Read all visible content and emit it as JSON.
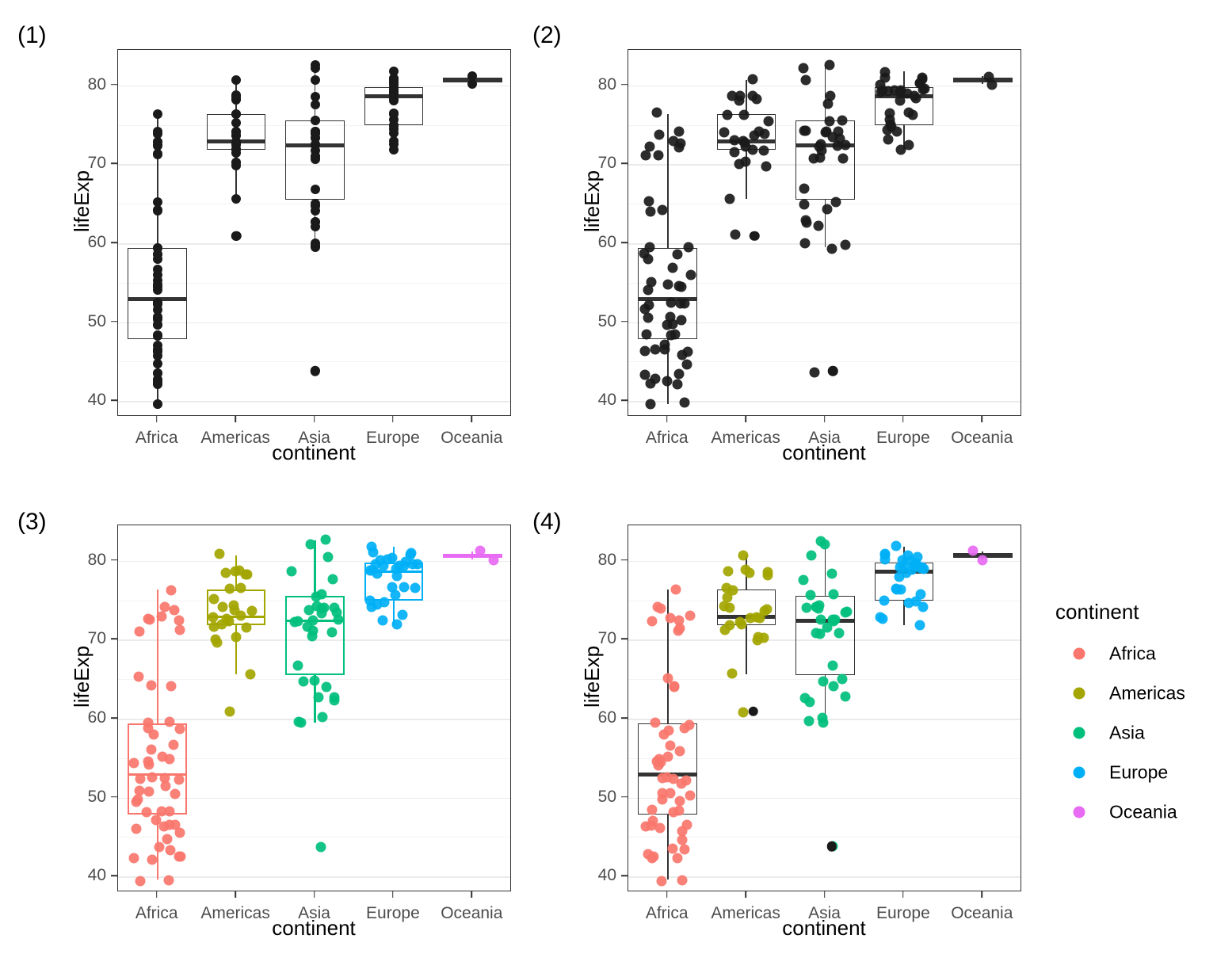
{
  "figure": {
    "panel_tags": [
      "(1)",
      "(2)",
      "(3)",
      "(4)"
    ],
    "axis_x_title": "continent",
    "axis_y_title": "lifeExp",
    "y_ticks": [
      "40",
      "50",
      "60",
      "70",
      "80"
    ],
    "x_ticks": [
      "Africa",
      "Americas",
      "Asia",
      "Europe",
      "Oceania"
    ]
  },
  "legend": {
    "title": "continent",
    "items": [
      {
        "label": "Africa",
        "color": "#F8766D"
      },
      {
        "label": "Americas",
        "color": "#A3A500"
      },
      {
        "label": "Asia",
        "color": "#00BF7D"
      },
      {
        "label": "Europe",
        "color": "#00B0F6"
      },
      {
        "label": "Oceania",
        "color": "#E76BF3"
      }
    ]
  },
  "style": {
    "point_black": "#1a1a1a",
    "box_black": "#333333",
    "grid_major": "#ebebeb",
    "grid_minor": "#f3f3f3",
    "panel_border": "#333333",
    "tick_text": "#4d4d4d"
  },
  "chart_data": {
    "type": "box",
    "title": "",
    "xlabel": "continent",
    "ylabel": "lifeExp",
    "ylim": [
      38.0,
      84.5
    ],
    "y_ticks": [
      40,
      50,
      60,
      70,
      80
    ],
    "y_minor_ticks": [
      45,
      55,
      65,
      75
    ],
    "grid": true,
    "legend_position": "right",
    "categories": [
      "Africa",
      "Americas",
      "Asia",
      "Europe",
      "Oceania"
    ],
    "panels": [
      {
        "tag": "(1)",
        "geoms": [
          "boxplot",
          "point"
        ],
        "jitter": false,
        "colored_points": false,
        "colored_boxes": false
      },
      {
        "tag": "(2)",
        "geoms": [
          "boxplot",
          "point-jitter"
        ],
        "jitter": true,
        "colored_points": false,
        "colored_boxes": false
      },
      {
        "tag": "(3)",
        "geoms": [
          "boxplot-colored",
          "point-jitter-colored"
        ],
        "jitter": true,
        "colored_points": true,
        "colored_boxes": true
      },
      {
        "tag": "(4)",
        "geoms": [
          "boxplot",
          "point-jitter-colored"
        ],
        "jitter": true,
        "colored_points": true,
        "colored_boxes": false
      }
    ],
    "boxstats": [
      {
        "category": "Africa",
        "min": 39.6,
        "q1": 47.8,
        "median": 52.9,
        "q3": 59.4,
        "max": 76.4,
        "lower_whisker": 39.6,
        "upper_whisker": 76.4,
        "outliers": [],
        "n": 52
      },
      {
        "category": "Americas",
        "min": 60.9,
        "q1": 71.8,
        "median": 72.9,
        "q3": 76.4,
        "max": 80.7,
        "lower_whisker": 65.6,
        "upper_whisker": 80.7,
        "outliers": [
          60.9
        ],
        "n": 25
      },
      {
        "category": "Asia",
        "min": 43.8,
        "q1": 65.5,
        "median": 72.4,
        "q3": 75.6,
        "max": 82.6,
        "lower_whisker": 59.5,
        "upper_whisker": 82.6,
        "outliers": [
          43.8
        ],
        "n": 33
      },
      {
        "category": "Europe",
        "min": 71.8,
        "q1": 75.0,
        "median": 78.6,
        "q3": 79.8,
        "max": 81.8,
        "lower_whisker": 71.8,
        "upper_whisker": 81.8,
        "outliers": [],
        "n": 30
      },
      {
        "category": "Oceania",
        "min": 80.2,
        "q1": 80.4,
        "median": 80.7,
        "q3": 80.9,
        "max": 81.2,
        "lower_whisker": 80.2,
        "upper_whisker": 81.2,
        "outliers": [],
        "n": 2
      }
    ],
    "values": {
      "Africa": [
        72.3,
        42.7,
        56.7,
        50.7,
        52.3,
        49.6,
        50.4,
        44.7,
        50.6,
        65.2,
        46.5,
        55.3,
        48.3,
        54.8,
        71.3,
        51.6,
        58.0,
        52.5,
        56.0,
        46.4,
        76.4,
        59.4,
        58.6,
        72.9,
        54.1,
        42.6,
        45.7,
        73.9,
        59.4,
        48.3,
        54.5,
        64.2,
        72.8,
        71.2,
        42.1,
        52.5,
        49.6,
        58.6,
        39.6,
        48.2,
        74.2,
        54.5,
        64.1,
        72.4,
        46.2,
        47.0,
        39.6,
        43.5,
        46.4,
        52.5,
        42.4,
        43.5
      ],
      "Americas": [
        75.3,
        65.6,
        72.4,
        80.7,
        78.6,
        72.9,
        78.8,
        78.3,
        76.4,
        73.7,
        74.2,
        71.8,
        71.9,
        78.2,
        72.9,
        70.2,
        60.9,
        70.2,
        72.6,
        71.4,
        74.1,
        78.7,
        69.8,
        76.4,
        73.7
      ],
      "Asia": [
        43.8,
        75.6,
        64.1,
        59.7,
        72.4,
        82.2,
        64.7,
        70.6,
        59.5,
        80.7,
        72.5,
        82.6,
        74.2,
        71.0,
        66.8,
        62.1,
        75.6,
        73.4,
        62.7,
        60.0,
        72.4,
        74.2,
        71.7,
        78.6,
        77.6,
        72.4,
        74.2,
        70.9,
        73.4,
        62.7,
        74.1,
        73.9,
        65.0
      ],
      "Europe": [
        76.4,
        79.8,
        79.4,
        74.9,
        73.0,
        75.7,
        76.5,
        78.3,
        79.3,
        80.7,
        79.4,
        79.5,
        78.9,
        80.9,
        80.5,
        74.5,
        71.8,
        79.4,
        80.2,
        80.2,
        78.1,
        72.5,
        79.0,
        80.9,
        74.0,
        75.0,
        76.5,
        78.8,
        79.3,
        81.8
      ],
      "Oceania": [
        81.2,
        80.2
      ]
    }
  }
}
